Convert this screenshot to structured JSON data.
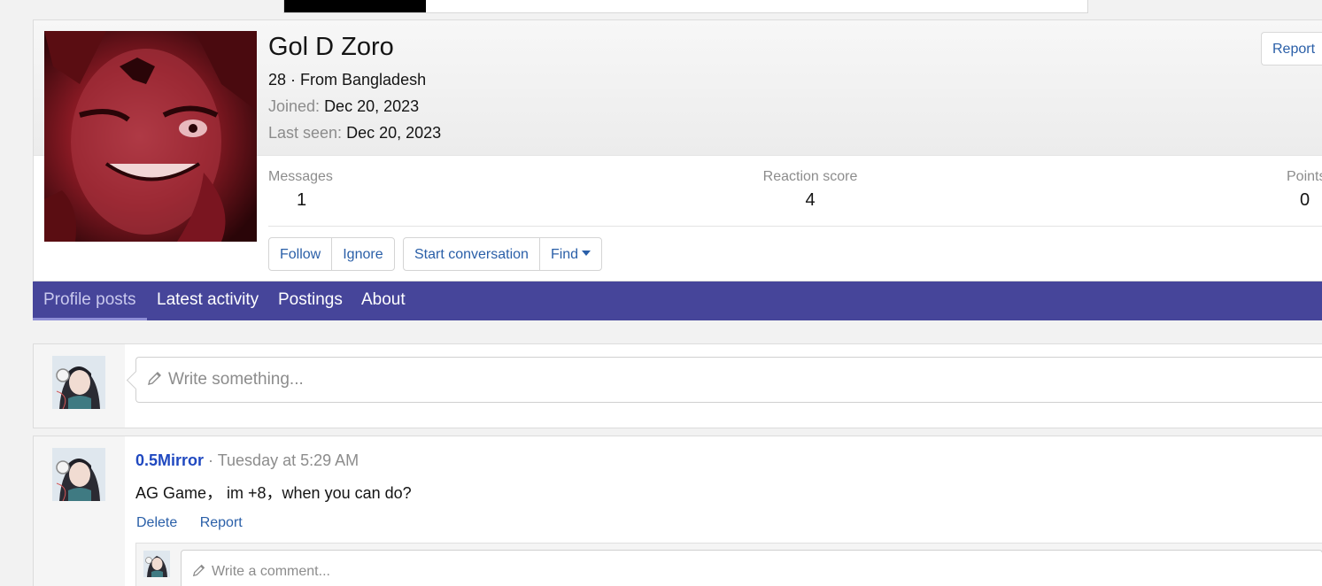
{
  "profile": {
    "name": "Gol D Zoro",
    "age_location": "28 · From Bangladesh",
    "joined_label": "Joined:",
    "joined_value": "Dec 20, 2023",
    "last_seen_label": "Last seen:",
    "last_seen_value": "Dec 20, 2023",
    "report_label": "Report",
    "stats": [
      {
        "label": "Messages",
        "value": "1"
      },
      {
        "label": "Reaction score",
        "value": "4"
      },
      {
        "label": "Points",
        "value": "0"
      }
    ],
    "actions": {
      "follow": "Follow",
      "ignore": "Ignore",
      "start_conversation": "Start conversation",
      "find": "Find"
    }
  },
  "tabs": [
    {
      "label": "Profile posts",
      "active": true
    },
    {
      "label": "Latest activity",
      "active": false
    },
    {
      "label": "Postings",
      "active": false
    },
    {
      "label": "About",
      "active": false
    }
  ],
  "composer": {
    "placeholder": "Write something..."
  },
  "post": {
    "author": "0.5Mirror",
    "separator": " · ",
    "time": "Tuesday at 5:29 AM",
    "body": "AG Game， im +8，when you can do?",
    "delete_label": "Delete",
    "report_label": "Report",
    "comment_placeholder": "Write a comment..."
  },
  "colors": {
    "tabs_bar": "#46459a",
    "link": "#2a5fa8",
    "username": "#2049c0"
  }
}
